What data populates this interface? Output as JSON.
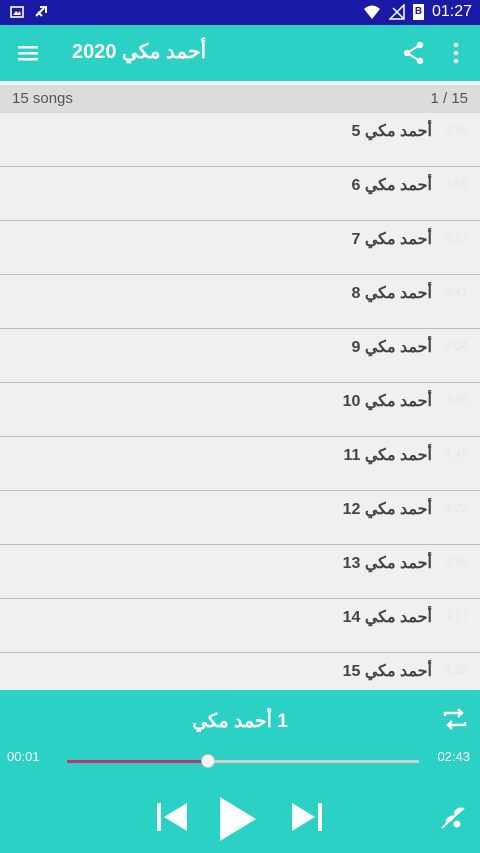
{
  "status_bar": {
    "time": "01:27",
    "battery": "B"
  },
  "app_bar": {
    "title": "أحمد مكي 2020"
  },
  "summary": {
    "count": "15 songs",
    "position": "1 / 15"
  },
  "songs": [
    {
      "number": "5",
      "title": "أحمد مكي",
      "duration": "3:30"
    },
    {
      "number": "6",
      "title": "أحمد مكي",
      "duration": "4:58"
    },
    {
      "number": "7",
      "title": "أحمد مكي",
      "duration": "3:27"
    },
    {
      "number": "8",
      "title": "أحمد مكي",
      "duration": "3:41"
    },
    {
      "number": "9",
      "title": "أحمد مكي",
      "duration": "4:04"
    },
    {
      "number": "10",
      "title": "أحمد مكي",
      "duration": "3:30"
    },
    {
      "number": "11",
      "title": "أحمد مكي",
      "duration": "3:45"
    },
    {
      "number": "12",
      "title": "أحمد مكي",
      "duration": "4:22"
    },
    {
      "number": "13",
      "title": "أحمد مكي",
      "duration": "3:59"
    },
    {
      "number": "14",
      "title": "أحمد مكي",
      "duration": "4:17"
    },
    {
      "number": "15",
      "title": "أحمد مكي",
      "duration": "3:50"
    }
  ],
  "player": {
    "now_playing": "1 أحمد مكي",
    "elapsed": "00:01",
    "total": "02:43",
    "progress": 0.4
  },
  "colors": {
    "accent": "#2ad1c4",
    "status_bar": "#1a1aa6",
    "seek_fill": "#c0346c"
  }
}
